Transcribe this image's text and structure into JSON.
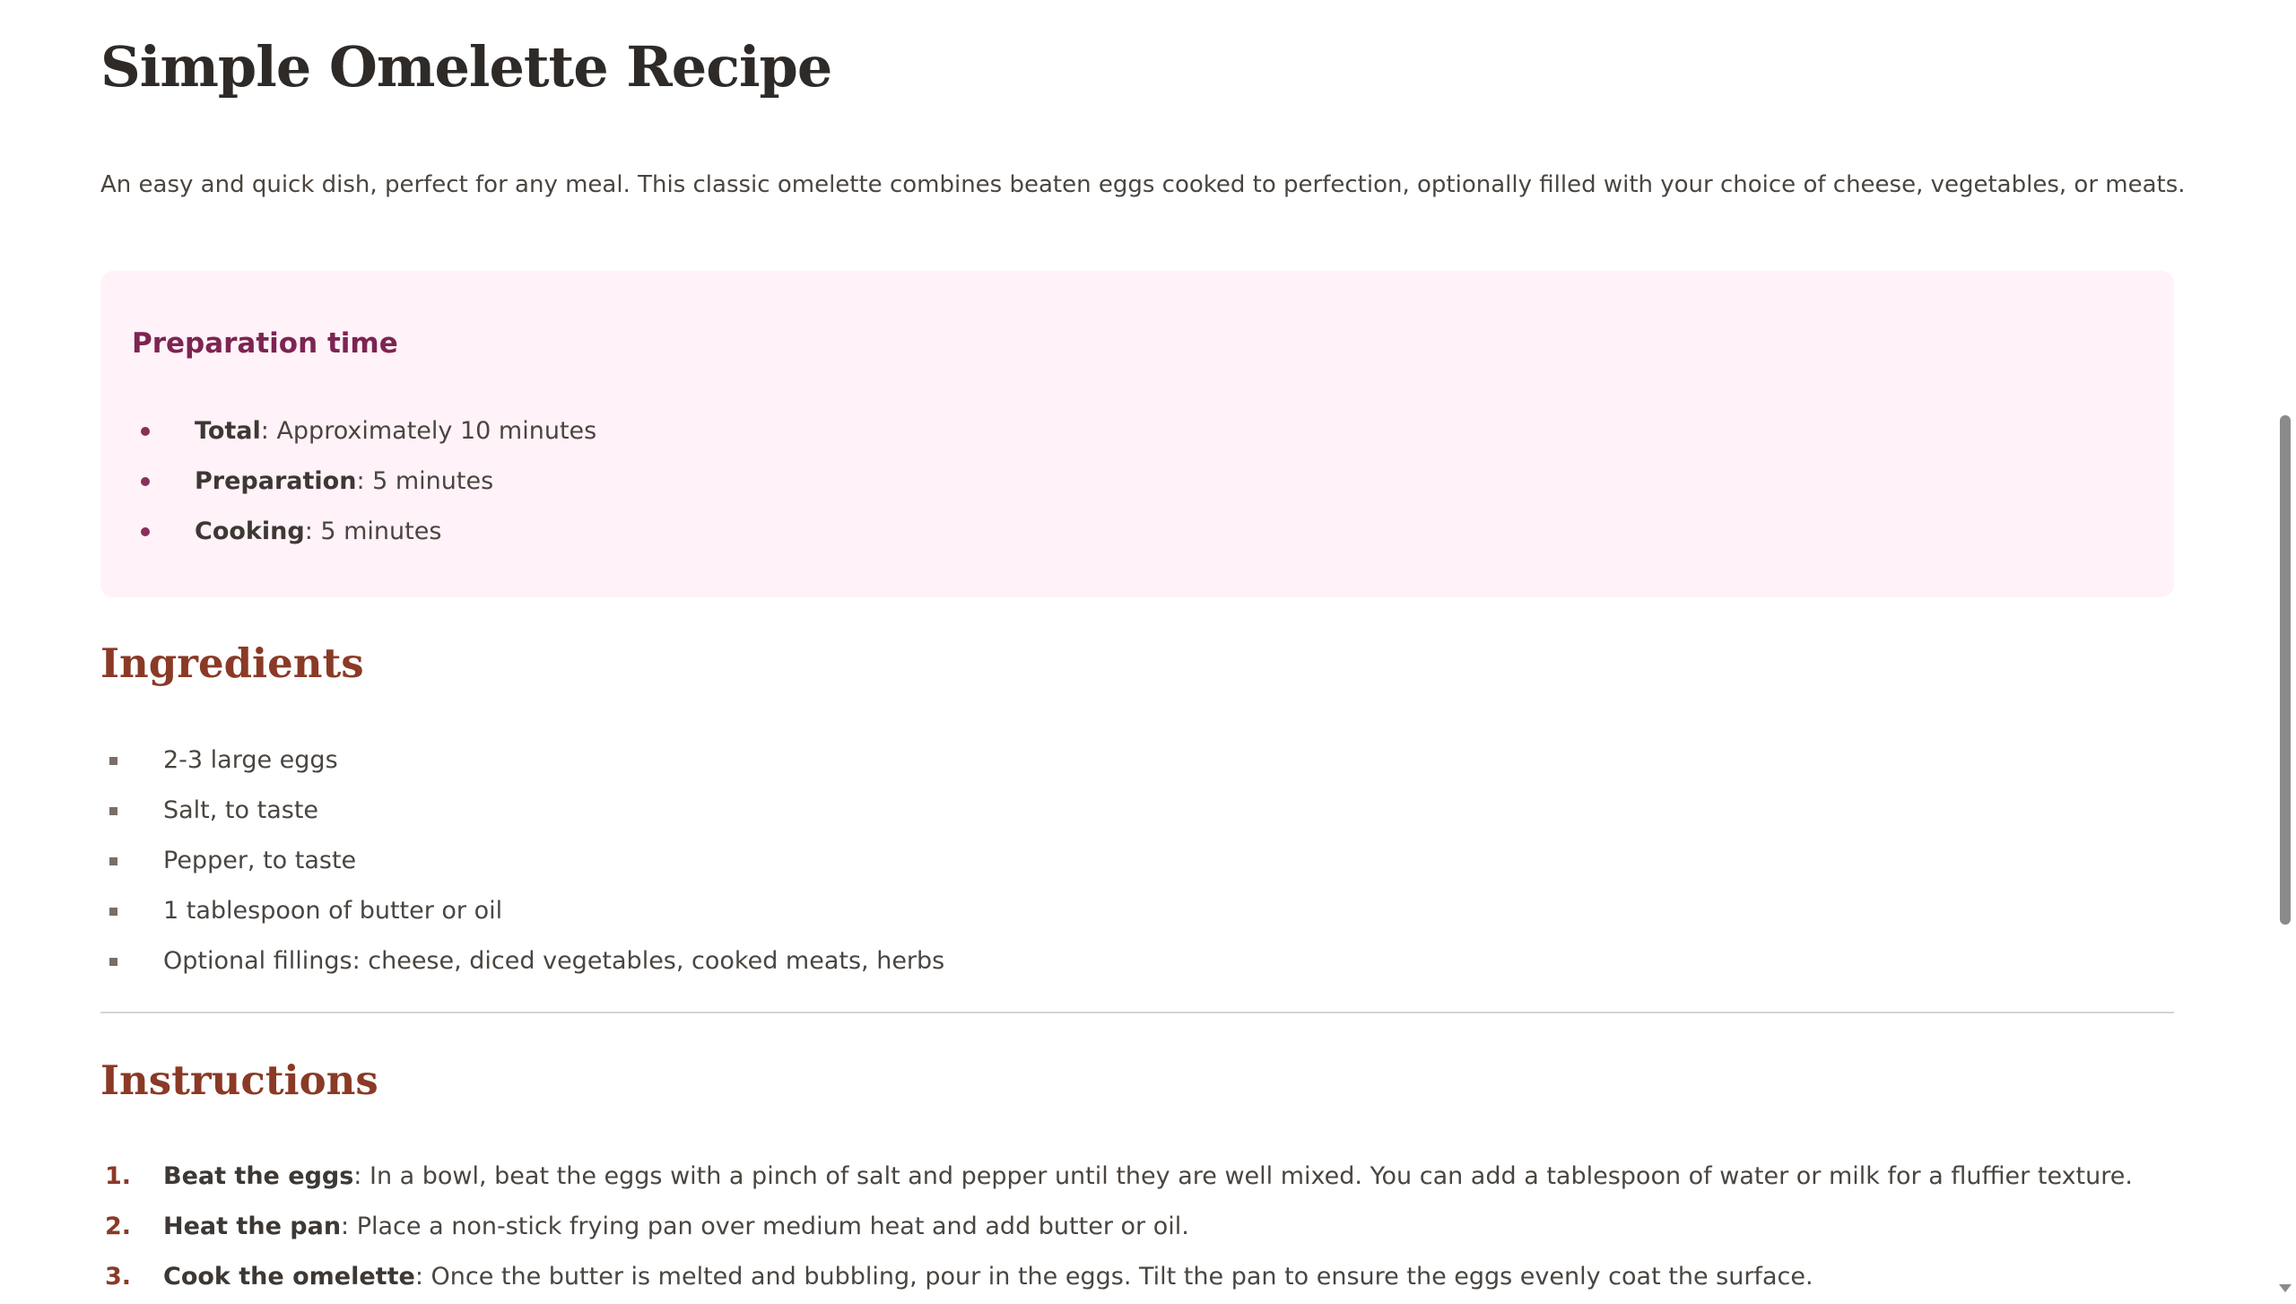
{
  "page": {
    "title": "Simple Omelette Recipe",
    "intro": "An easy and quick dish, perfect for any meal. This classic omelette combines beaten eggs cooked to perfection, optionally filled with your choice of cheese, vegetables, or meats."
  },
  "prep": {
    "heading": "Preparation time",
    "items": [
      {
        "label": "Total",
        "value": ": Approximately 10 minutes"
      },
      {
        "label": "Preparation",
        "value": ": 5 minutes"
      },
      {
        "label": "Cooking",
        "value": ": 5 minutes"
      }
    ]
  },
  "ingredients": {
    "heading": "Ingredients",
    "items": [
      "2-3 large eggs",
      "Salt, to taste",
      "Pepper, to taste",
      "1 tablespoon of butter or oil",
      "Optional fillings: cheese, diced vegetables, cooked meats, herbs"
    ]
  },
  "instructions": {
    "heading": "Instructions",
    "steps": [
      {
        "number": "1.",
        "label": "Beat the eggs",
        "text": ": In a bowl, beat the eggs with a pinch of salt and pepper until they are well mixed. You can add a tablespoon of water or milk for a fluffier texture."
      },
      {
        "number": "2.",
        "label": "Heat the pan",
        "text": ": Place a non-stick frying pan over medium heat and add butter or oil."
      },
      {
        "number": "3.",
        "label": "Cook the omelette",
        "text": ": Once the butter is melted and bubbling, pour in the eggs. Tilt the pan to ensure the eggs evenly coat the surface."
      }
    ]
  },
  "colors": {
    "title": "#2e2a27",
    "section_heading": "#8a3a26",
    "prep_heading": "#7d2452",
    "prep_box_bg": "#fff2f8",
    "body_text": "#4a4540"
  }
}
